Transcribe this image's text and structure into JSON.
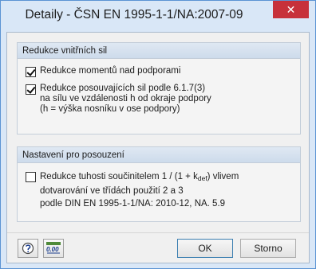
{
  "window": {
    "title": "Detaily - ČSN EN 1995-1-1/NA:2007-09",
    "close_label": "✕"
  },
  "group1": {
    "header": "Redukce vnitřních sil",
    "options": [
      {
        "checked": true,
        "lines": [
          "Redukce momentů nad podporami"
        ]
      },
      {
        "checked": true,
        "lines": [
          "Redukce posouvajících sil podle 6.1.7(3)",
          "na sílu ve vzdálenosti h od okraje podpory",
          "(h = výška nosníku v ose podpory)"
        ]
      }
    ]
  },
  "group2": {
    "header": "Nastavení pro posouzení",
    "option": {
      "checked": false,
      "line1_pre": "Redukce tuhosti součinitelem 1 / (1 + k",
      "line1_sub": "def",
      "line1_post": ") vlivem",
      "line2": "dotvarování ve třídách použití 2 a 3",
      "line3": "podle DIN EN 1995-1-1/NA: 2010-12, NA. 5.9"
    }
  },
  "footer": {
    "ok_label": "OK",
    "cancel_label": "Storno",
    "units_icon_text": "0.00"
  },
  "colors": {
    "title_bg": "#d9e7f7",
    "close_bg": "#c7313a",
    "group_header": "#cddbeb"
  }
}
